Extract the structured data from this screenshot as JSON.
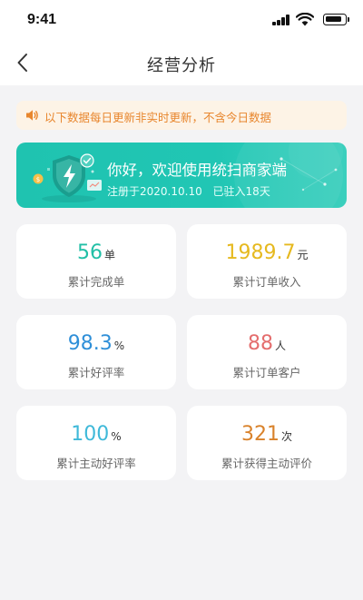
{
  "status_bar": {
    "time": "9:41"
  },
  "header": {
    "title": "经营分析"
  },
  "notice": {
    "text": "以下数据每日更新非实时更新，不含今日数据",
    "color": "#e8862d"
  },
  "banner": {
    "title": "你好，欢迎使用统扫商家端",
    "registered": "注册于2020.10.10",
    "days": "已驻入18天"
  },
  "stats": [
    {
      "value": "56",
      "unit": "单",
      "label": "累计完成单",
      "color": "#21bfa6"
    },
    {
      "value": "1989.7",
      "unit": "元",
      "label": "累计订单收入",
      "color": "#e6b91f"
    },
    {
      "value": "98.3",
      "unit": "%",
      "label": "累计好评率",
      "color": "#2f8fd8"
    },
    {
      "value": "88",
      "unit": "人",
      "label": "累计订单客户",
      "color": "#e46d6d"
    },
    {
      "value": "100",
      "unit": "%",
      "label": "累计主动好评率",
      "color": "#3fb9d9"
    },
    {
      "value": "321",
      "unit": "次",
      "label": "累计获得主动评价",
      "color": "#d9822b"
    }
  ]
}
